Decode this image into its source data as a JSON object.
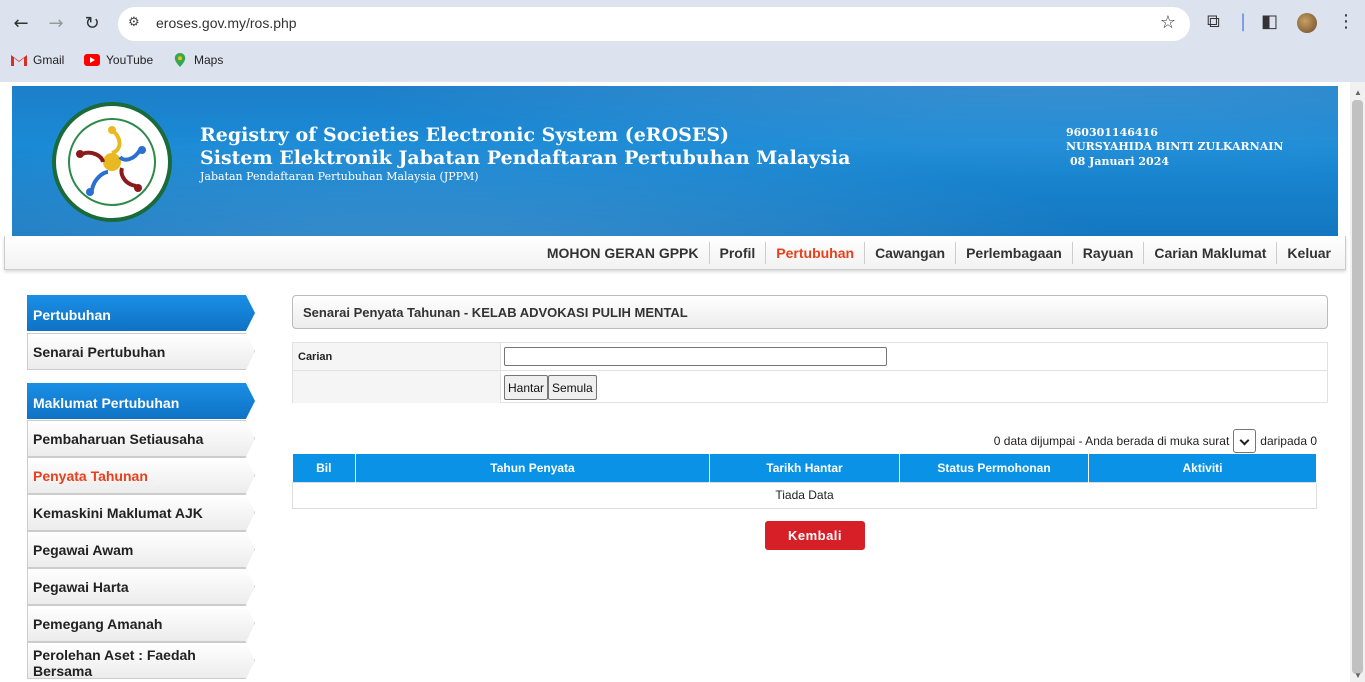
{
  "browser": {
    "url": "eroses.gov.my/ros.php",
    "bookmarks": [
      {
        "label": "Gmail",
        "icon": "gmail-icon"
      },
      {
        "label": "YouTube",
        "icon": "youtube-icon"
      },
      {
        "label": "Maps",
        "icon": "maps-icon"
      }
    ]
  },
  "header": {
    "title1": "Registry of Societies Electronic System (eROSES)",
    "title2": "Sistem Elektronik Jabatan Pendaftaran Pertubuhan Malaysia",
    "title3": "Jabatan Pendaftaran Pertubuhan Malaysia (JPPM)",
    "user_id": "960301146416",
    "user_name": "NURSYAHIDA BINTI ZULKARNAIN",
    "date": "08 Januari 2024"
  },
  "menu": [
    {
      "label": "MOHON GERAN GPPK",
      "active": false
    },
    {
      "label": "Profil",
      "active": false
    },
    {
      "label": "Pertubuhan",
      "active": true
    },
    {
      "label": "Cawangan",
      "active": false
    },
    {
      "label": "Perlembagaan",
      "active": false
    },
    {
      "label": "Rayuan",
      "active": false
    },
    {
      "label": "Carian Maklumat",
      "active": false
    },
    {
      "label": "Keluar",
      "active": false
    }
  ],
  "sidebar": {
    "section1": "Pertubuhan",
    "section1_items": [
      "Senarai Pertubuhan"
    ],
    "section2": "Maklumat Pertubuhan",
    "section2_items": [
      "Pembaharuan Setiausaha",
      "Penyata Tahunan",
      "Kemaskini Maklumat AJK",
      "Pegawai Awam",
      "Pegawai Harta",
      "Pemegang Amanah",
      "Perolehan Aset : Faedah Bersama"
    ],
    "active_item": "Penyata Tahunan"
  },
  "main": {
    "panel_title": "Senarai Penyata Tahunan - KELAB ADVOKASI PULIH MENTAL",
    "search_label": "Carian",
    "search_value": "",
    "submit_label": "Hantar",
    "reset_label": "Semula",
    "pager_text": "0 data dijumpai - Anda berada di muka surat",
    "pager_suffix": "daripada 0",
    "table_headers": [
      "Bil",
      "Tahun Penyata",
      "Tarikh Hantar",
      "Status Permohonan",
      "Aktiviti"
    ],
    "empty_text": "Tiada Data",
    "back_label": "Kembali"
  },
  "colors": {
    "accent_active": "#e8401c",
    "table_header": "#0a93e6",
    "back_button": "#d71f27"
  }
}
